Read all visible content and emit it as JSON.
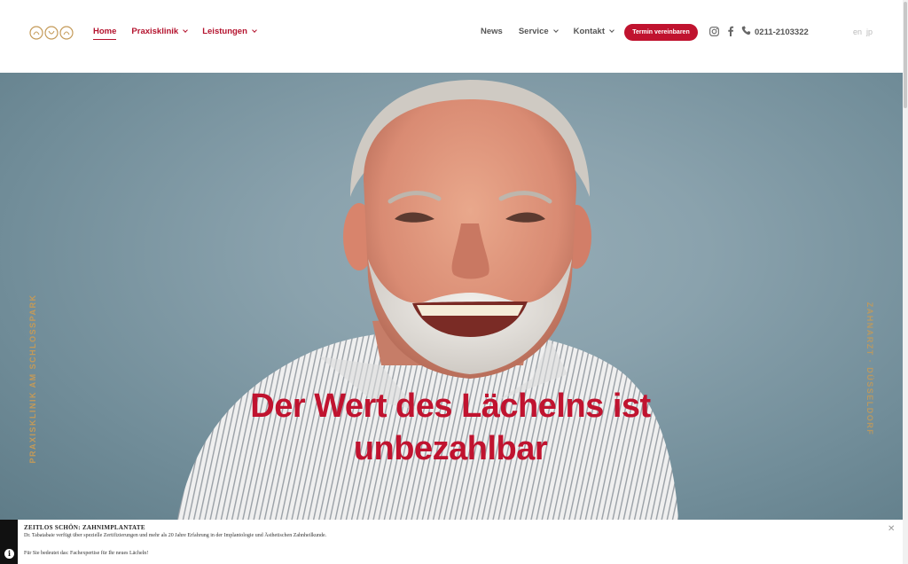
{
  "header": {
    "nav_left": [
      {
        "label": "Home",
        "active": true,
        "dropdown": false
      },
      {
        "label": "Praxisklinik",
        "active": false,
        "dropdown": true
      },
      {
        "label": "Leistungen",
        "active": false,
        "dropdown": true
      }
    ],
    "nav_right": [
      {
        "label": "News",
        "dropdown": false
      },
      {
        "label": "Service",
        "dropdown": true
      },
      {
        "label": "Kontakt",
        "dropdown": true
      }
    ],
    "cta_label": "Termin vereinbaren",
    "phone": "0211-2103322",
    "languages": [
      "en",
      "jp"
    ]
  },
  "hero": {
    "side_left": "PRAXISKLINIK AM SCHLOSSPARK",
    "side_right": "ZAHNARZT · DÜSSELDORF",
    "headline_line1": "Der Wert des Lächelns ist",
    "headline_line2": "unbezahlbar"
  },
  "infobar": {
    "title": "ZEITLOS SCHÖN: ZAHNIMPLANTATE",
    "text": "Dr. Tabatabaie verfügt über spezielle Zertifizierungen und mehr als 20 Jahre Erfahrung in der Implantologie und Ästhetischen Zahnheilkunde.",
    "text2": "Für Sie bedeutet das: Fachexpertise für Ihr neues Lächeln!",
    "close": "✕",
    "info_icon": "i"
  },
  "colors": {
    "brand_red": "#c0132f",
    "gold": "#c49a58"
  }
}
